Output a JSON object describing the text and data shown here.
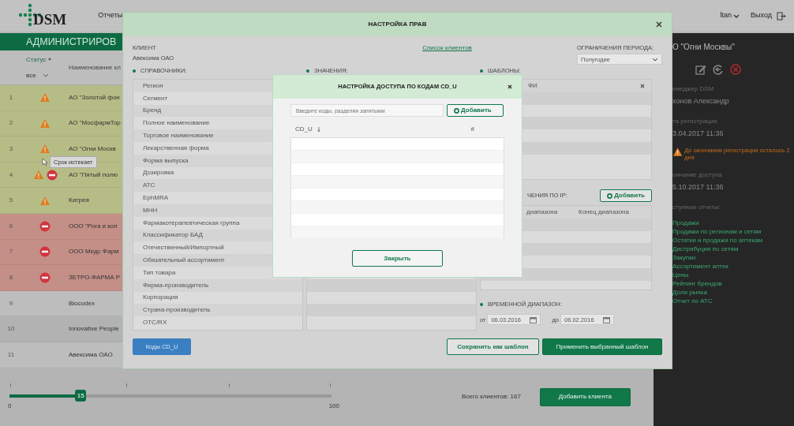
{
  "header": {
    "logo": "DSM",
    "menu": "Отчеты",
    "user": "ltan",
    "logout": "Выход"
  },
  "page_title": "АДМИНИСТРИРОВ",
  "table": {
    "status_column": "Статус",
    "status_filter": "все",
    "name_column": "Наименование кл",
    "rows": [
      {
        "number": "1",
        "kind": "active",
        "warning": true,
        "blocked": false,
        "name": "АО \"Золотой фон"
      },
      {
        "number": "2",
        "kind": "active",
        "warning": true,
        "blocked": false,
        "name": "АО \"МосфармТор"
      },
      {
        "number": "3",
        "kind": "active",
        "warning": true,
        "blocked": false,
        "name": "АО \"Огни Москв"
      },
      {
        "number": "4",
        "kind": "active",
        "warning": true,
        "blocked": true,
        "name": "АО \"Пятый полю"
      },
      {
        "number": "5",
        "kind": "active",
        "warning": true,
        "blocked": false,
        "name": "Катрея"
      },
      {
        "number": "6",
        "kind": "expired",
        "warning": false,
        "blocked": true,
        "name": "ООО \"Рога и коп"
      },
      {
        "number": "7",
        "kind": "expired",
        "warning": false,
        "blocked": true,
        "name": "ООО Медс Фарм"
      },
      {
        "number": "8",
        "kind": "expired",
        "warning": false,
        "blocked": true,
        "name": "ЗЕТРО-ФАРМА Р"
      },
      {
        "number": "9",
        "kind": "plain",
        "warning": false,
        "blocked": false,
        "name": "Biocodex"
      },
      {
        "number": "10",
        "kind": "plain",
        "warning": false,
        "blocked": false,
        "name": "Innovative People"
      },
      {
        "number": "11",
        "kind": "plain",
        "warning": false,
        "blocked": false,
        "name": "Авексима ОАО"
      }
    ]
  },
  "tooltip": "Срок истекает",
  "slider": {
    "min": "0",
    "max": "100",
    "thumb": "15",
    "level": 0.22
  },
  "total": "Всего клиентов: 167",
  "add_client": "Добавить клиента",
  "sidebar": {
    "client": "О \"Огни Москвы\"",
    "fields": [
      {
        "label": "енеджер DSM",
        "value": "хонов Александр"
      },
      {
        "label": "та регистрации",
        "value": "3.04.2017 11:36"
      }
    ],
    "warning": "До окончания регистрации осталось 2 дня",
    "fields2": [
      {
        "label": "ончание доступа",
        "value": "5.10.2017 11:36"
      }
    ],
    "reports_label": "ступные отчеты:",
    "reports": [
      "Продажи",
      "Продажи по регионам и сетям",
      "Остатки и продажи по аптекам",
      "Дистрибуция по сетям",
      "Закупки",
      "Ассортимент аптек",
      "Цены",
      "Рейтинг брендов",
      "Доли рынка",
      "Отчет по ATC"
    ]
  },
  "rights_dialog": {
    "title": "НАСТРОЙКА ПРАВ",
    "client_label": "КЛИЕНТ",
    "client": "Авексима ОАО",
    "clients_link": "Список клиентов",
    "period_label": "ОГРАНИЧЕНИЯ ПЕРИОДА:",
    "period": "Полугодие",
    "dict_label": "СПРАВОЧНИКИ:",
    "dictionaries": [
      "Регион",
      "Сегмент",
      "Бренд",
      "Полное наименование",
      "Торговое наименование",
      "Лекарственная форма",
      "Форма выпуска",
      "Дозировка",
      "АТС",
      "EphMRA",
      "МНН",
      "Фармакотерапевтическая группа",
      "Классификатор БАД",
      "Отечественный/Импортный",
      "Обязательный ассортимент",
      "Тип товара",
      "Фирма-производитель",
      "Корпорация",
      "Страна-производитель",
      "ОТС/RX"
    ],
    "values_label": "ЗНАЧЕНИЯ:",
    "templates_label": "ШАБЛОНЫ:",
    "templates_column": "ФИ",
    "ip_label": "ЧЕНИЯ ПО IP:",
    "ip_add": "Добавить",
    "ip_columns": [
      "диапазона",
      "Конец диапазона"
    ],
    "range_label": "ВРЕМЕННОЙ ДИАПАЗОН:",
    "from_label": "от",
    "from": "06.03.2016",
    "to_label": "до",
    "to": "06.02.2016",
    "codes_button": "Коды CD_U",
    "save_button": "Сохранить как шаблон",
    "apply_button": "Применить выбранный шаблон"
  },
  "codes_dialog": {
    "title": "НАСТРОЙКА ДОСТУПА ПО КОДАМ CD_U",
    "placeholder": "Введите коды, разделяя запятыми",
    "add": "Добавить",
    "columns": [
      "CD_U",
      "#"
    ],
    "close": "Закрыть"
  }
}
